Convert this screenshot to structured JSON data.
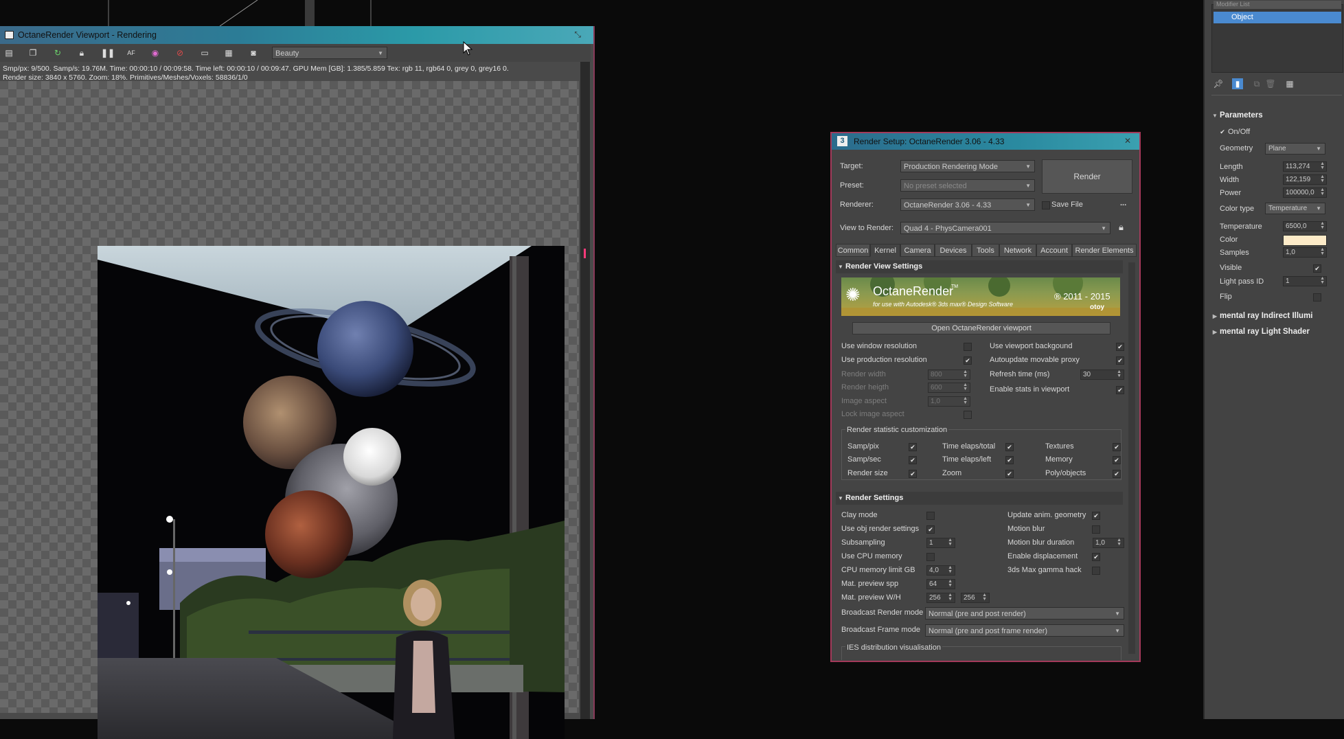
{
  "viewport": {
    "title": "OctaneRender Viewport - Rendering",
    "pass_select": "Beauty",
    "stats_line1": "Smp/px: 9/500.   Samp/s: 19.76M.   Time: 00:00:10 / 00:09:58.   Time left: 00:00:10 / 00:09:47.   GPU Mem [GB]: 1.385/5.859   Tex: rgb 11, rgb64 0, grey 0, grey16 0.",
    "stats_line2": "Render size: 3840 x 5760.   Zoom: 18%.   Primitives/Meshes/Voxels: 58836/1/0",
    "toolbar_icons": [
      "save-icon",
      "copy-icon",
      "refresh-icon",
      "lock-icon",
      "pause-icon",
      "af-icon",
      "color-picker-icon",
      "no-entry-icon",
      "region-icon",
      "clay-icon",
      "camera-icon"
    ]
  },
  "render_setup": {
    "window_number": "3",
    "title": "Render Setup: OctaneRender 3.06 - 4.33",
    "target_label": "Target:",
    "target_value": "Production Rendering Mode",
    "preset_label": "Preset:",
    "preset_value": "No preset selected",
    "renderer_label": "Renderer:",
    "renderer_value": "OctaneRender 3.06 - 4.33",
    "save_file_label": "Save File",
    "more_label": "...",
    "render_button": "Render",
    "view_label": "View to Render:",
    "view_value": "Quad 4 - PhysCamera001",
    "tabs": [
      "Common",
      "Kernel",
      "Camera",
      "Devices",
      "Tools",
      "Network",
      "Account",
      "Render Elements"
    ],
    "active_tab": "Kernel",
    "section_view": "Render View Settings",
    "banner_title": "OctaneRender",
    "banner_tm": "TM",
    "banner_sub": "for use with Autodesk® 3ds max® Design Software",
    "banner_years": "® 2011 - 2015",
    "banner_brand": "otoy",
    "open_viewport_button": "Open OctaneRender viewport",
    "left_opts": {
      "use_window_res": "Use window resolution",
      "use_prod_res": "Use production resolution",
      "render_width": "Render width",
      "render_width_val": "800",
      "render_height": "Render heigth",
      "render_height_val": "600",
      "image_aspect": "Image aspect",
      "image_aspect_val": "1,0",
      "lock_aspect": "Lock image aspect"
    },
    "right_opts": {
      "use_vp_bg": "Use viewport backgound",
      "autoupdate_proxy": "Autoupdate movable proxy",
      "refresh_time": "Refresh time (ms)",
      "refresh_time_val": "30",
      "enable_stats": "Enable stats in viewport"
    },
    "stat_group_title": "Render statistic customization",
    "stat_items": {
      "c1": [
        "Samp/pix",
        "Samp/sec",
        "Render size"
      ],
      "c2": [
        "Time elaps/total",
        "Time elaps/left",
        "Zoom"
      ],
      "c3": [
        "Textures",
        "Memory",
        "Poly/objects"
      ]
    },
    "section_render": "Render Settings",
    "rs_left": {
      "clay_mode": "Clay mode",
      "use_obj": "Use obj render settings",
      "subsampling": "Subsampling",
      "subsampling_val": "1",
      "use_cpu_mem": "Use CPU memory",
      "cpu_mem_limit": "CPU memory limit GB",
      "cpu_mem_limit_val": "4,0",
      "mat_spp": "Mat. preview spp",
      "mat_spp_val": "64",
      "mat_wh": "Mat. preview W/H",
      "mat_w_val": "256",
      "mat_h_val": "256",
      "broadcast_render": "Broadcast Render mode",
      "broadcast_render_val": "Normal (pre and post render)",
      "broadcast_frame": "Broadcast Frame mode",
      "broadcast_frame_val": "Normal (pre and post frame render)",
      "ies": "IES distribution visualisation"
    },
    "rs_right": {
      "update_anim": "Update anim. geometry",
      "motion_blur": "Motion blur",
      "motion_blur_dur": "Motion blur duration",
      "motion_blur_dur_val": "1,0",
      "enable_disp": "Enable displacement",
      "gamma_hack": "3ds Max gamma hack"
    }
  },
  "command_panel": {
    "list_header": "Modifier List",
    "list_item": "Object",
    "parameters": "Parameters",
    "on_off": "On/Off",
    "geometry_label": "Geometry",
    "geometry_val": "Plane",
    "length_label": "Length",
    "length_val": "113,274",
    "width_label": "Width",
    "width_val": "122,159",
    "power_label": "Power",
    "power_val": "100000,0",
    "color_type_label": "Color type",
    "color_type_val": "Temperature",
    "temperature_label": "Temperature",
    "temperature_val": "6500,0",
    "color_label": "Color",
    "color_swatch": "#fdebc8",
    "samples_label": "Samples",
    "samples_val": "1,0",
    "visible_label": "Visible",
    "light_pass_label": "Light pass ID",
    "light_pass_val": "1",
    "flip_label": "Flip",
    "rollout1": "mental ray Indirect Illumi",
    "rollout2": "mental ray Light Shader"
  }
}
